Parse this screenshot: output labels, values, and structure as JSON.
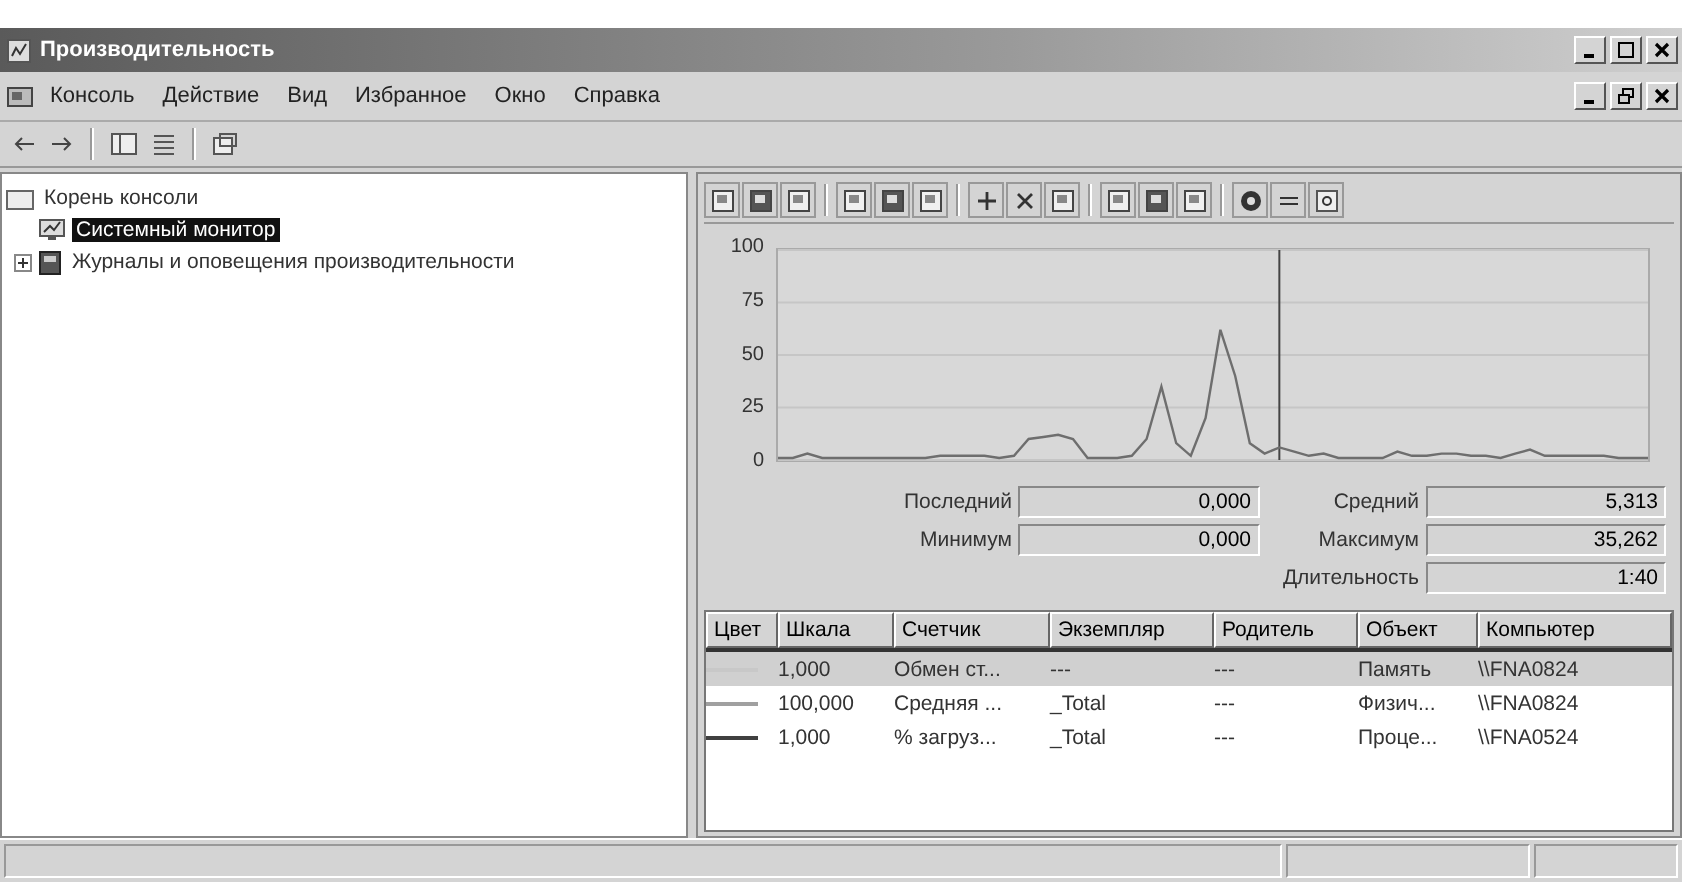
{
  "window": {
    "title": "Производительность"
  },
  "menu": [
    "Консоль",
    "Действие",
    "Вид",
    "Избранное",
    "Окно",
    "Справка"
  ],
  "tree": [
    {
      "label": "Корень консоли",
      "selected": false,
      "children": [
        {
          "label": "Системный монитор",
          "selected": true
        },
        {
          "label": "Журналы и оповещения производительности",
          "selected": false,
          "expanded": false
        }
      ]
    }
  ],
  "chart_data": {
    "type": "line",
    "ylim": [
      0,
      100
    ],
    "yticks": [
      0,
      25,
      50,
      75,
      100
    ],
    "grid": true,
    "values": [
      1,
      1,
      3,
      1,
      1,
      1,
      1,
      1,
      1,
      1,
      1,
      2,
      2,
      2,
      2,
      1,
      2,
      10,
      11,
      12,
      10,
      1,
      1,
      1,
      2,
      10,
      35,
      8,
      2,
      20,
      62,
      40,
      8,
      3,
      6,
      4,
      2,
      3,
      1,
      1,
      1,
      1,
      4,
      2,
      2,
      3,
      3,
      2,
      2,
      1,
      3,
      5,
      2,
      2,
      2,
      2,
      2,
      1,
      1,
      1
    ]
  },
  "stats": [
    {
      "label": "Последний",
      "value": "0,000"
    },
    {
      "label": "Средний",
      "value": "5,313"
    },
    {
      "label": "Минимум",
      "value": "0,000"
    },
    {
      "label": "Максимум",
      "value": "35,262"
    },
    {
      "label": "Длительность",
      "value": "1:40"
    }
  ],
  "legend": {
    "columns": [
      "Цвет",
      "Шкала",
      "Счетчик",
      "Экземпляр",
      "Родитель",
      "Объект",
      "Компьютер"
    ],
    "rows": [
      {
        "color": "#c8c8c8",
        "selected": true,
        "cells": [
          "",
          "1,000",
          "Обмен ст...",
          "---",
          "---",
          "Память",
          "\\\\FNA0824"
        ]
      },
      {
        "color": "#a0a0a0",
        "selected": false,
        "cells": [
          "",
          "100,000",
          "Средняя ...",
          "_Total",
          "---",
          "Физич...",
          "\\\\FNA0824"
        ]
      },
      {
        "color": "#404040",
        "selected": false,
        "cells": [
          "",
          "1,000",
          "% загруз...",
          "_Total",
          "---",
          "Проце...",
          "\\\\FNA0524"
        ]
      }
    ]
  }
}
